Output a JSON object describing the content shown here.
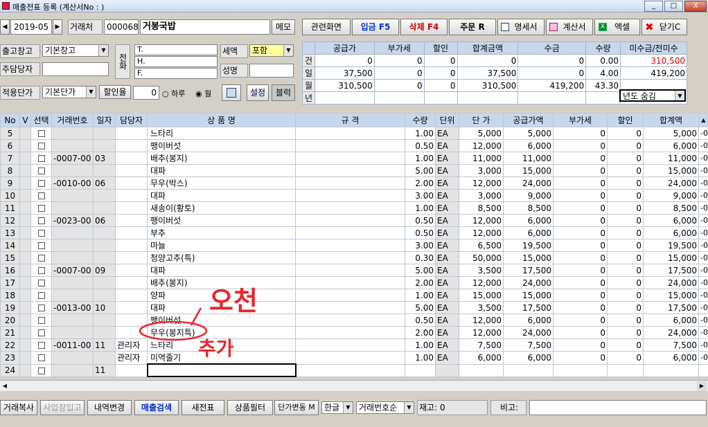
{
  "window": {
    "title": "매출전표 등록 (계산서No : )",
    "min": "_",
    "max": "□",
    "close": "X"
  },
  "header": {
    "date": "2019-05",
    "partner_label": "거래처",
    "partner_code": "000068",
    "partner_name": "거봉국밥",
    "memo_label": "메모"
  },
  "toolbar": {
    "related": "관련화면",
    "deposit": "입금 F5",
    "delete": "삭제 F4",
    "order": "주문 R",
    "statement": "명세서",
    "invoice": "계산서",
    "excel": "엑셀",
    "close": "닫기C"
  },
  "form": {
    "warehouse_label": "출고창고",
    "warehouse_value": "기본창고",
    "staff_label": "주담당자",
    "staff_value": "",
    "price_label": "적용단가",
    "price_value": "기본단가",
    "discount_label": "할인율",
    "discount_value": "0",
    "radio_day": "하루",
    "radio_month": "월",
    "setting_label": "설정",
    "block_label": "블럭",
    "phone_label": "전화",
    "phone_T": "T.",
    "phone_H": "H.",
    "phone_F": "F.",
    "tax_label": "세액",
    "tax_value": "포함",
    "name_label": "성명",
    "name_value": ""
  },
  "summary": {
    "headers": [
      "",
      "공급가",
      "부가세",
      "할인",
      "합계금액",
      "수금",
      "수량",
      "미수금/전미수"
    ],
    "rows": [
      [
        "건",
        "0",
        "0",
        "0",
        "0",
        "0",
        "0.00",
        "310,500"
      ],
      [
        "일",
        "37,500",
        "0",
        "0",
        "37,500",
        "0",
        "4.00",
        "419,200"
      ],
      [
        "월",
        "310,500",
        "0",
        "0",
        "310,500",
        "419,200",
        "43.30",
        ""
      ],
      [
        "년",
        "",
        "",
        "",
        "",
        "",
        "",
        ""
      ]
    ],
    "year_combo": "년도 숨김"
  },
  "grid": {
    "headers": [
      "No",
      "V",
      "선택",
      "거래번호",
      "일자",
      "담당자",
      "상 품 명",
      "규 격",
      "수량",
      "단위",
      "단 가",
      "공급가액",
      "부가세",
      "할인",
      "합계액"
    ],
    "rows": [
      {
        "no": "5",
        "tx": "",
        "date": "",
        "staff": "",
        "name": "느타리",
        "qty": "1.00",
        "unit": "EA",
        "price": "5,000",
        "supply": "5,000",
        "vat": "0",
        "disc": "0",
        "total": "5,000"
      },
      {
        "no": "6",
        "tx": "",
        "date": "",
        "staff": "",
        "name": "팽이버섯",
        "qty": "0.50",
        "unit": "EA",
        "price": "12,000",
        "supply": "6,000",
        "vat": "0",
        "disc": "0",
        "total": "6,000"
      },
      {
        "no": "7",
        "tx": "-0007-00",
        "date": "03",
        "staff": "",
        "name": "배추(봉지)",
        "qty": "1.00",
        "unit": "EA",
        "price": "11,000",
        "supply": "11,000",
        "vat": "0",
        "disc": "0",
        "total": "11,000"
      },
      {
        "no": "8",
        "tx": "",
        "date": "",
        "staff": "",
        "name": "대파",
        "qty": "5.00",
        "unit": "EA",
        "price": "3,000",
        "supply": "15,000",
        "vat": "0",
        "disc": "0",
        "total": "15,000"
      },
      {
        "no": "9",
        "tx": "-0010-00",
        "date": "06",
        "staff": "",
        "name": "무우(박스)",
        "qty": "2.00",
        "unit": "EA",
        "price": "12,000",
        "supply": "24,000",
        "vat": "0",
        "disc": "0",
        "total": "24,000"
      },
      {
        "no": "10",
        "tx": "",
        "date": "",
        "staff": "",
        "name": "대파",
        "qty": "3.00",
        "unit": "EA",
        "price": "3,000",
        "supply": "9,000",
        "vat": "0",
        "disc": "0",
        "total": "9,000"
      },
      {
        "no": "11",
        "tx": "",
        "date": "",
        "staff": "",
        "name": "새송이(황토)",
        "qty": "1.00",
        "unit": "EA",
        "price": "8,500",
        "supply": "8,500",
        "vat": "0",
        "disc": "0",
        "total": "8,500"
      },
      {
        "no": "12",
        "tx": "-0023-00",
        "date": "06",
        "staff": "",
        "name": "팽이버섯",
        "qty": "0.50",
        "unit": "EA",
        "price": "12,000",
        "supply": "6,000",
        "vat": "0",
        "disc": "0",
        "total": "6,000"
      },
      {
        "no": "13",
        "tx": "",
        "date": "",
        "staff": "",
        "name": "부추",
        "qty": "0.50",
        "unit": "EA",
        "price": "12,000",
        "supply": "6,000",
        "vat": "0",
        "disc": "0",
        "total": "6,000"
      },
      {
        "no": "14",
        "tx": "",
        "date": "",
        "staff": "",
        "name": "마늘",
        "qty": "3.00",
        "unit": "EA",
        "price": "6,500",
        "supply": "19,500",
        "vat": "0",
        "disc": "0",
        "total": "19,500"
      },
      {
        "no": "15",
        "tx": "",
        "date": "",
        "staff": "",
        "name": "청양고추(특)",
        "qty": "0.30",
        "unit": "EA",
        "price": "50,000",
        "supply": "15,000",
        "vat": "0",
        "disc": "0",
        "total": "15,000"
      },
      {
        "no": "16",
        "tx": "-0007-00",
        "date": "09",
        "staff": "",
        "name": "대파",
        "qty": "5.00",
        "unit": "EA",
        "price": "3,500",
        "supply": "17,500",
        "vat": "0",
        "disc": "0",
        "total": "17,500"
      },
      {
        "no": "17",
        "tx": "",
        "date": "",
        "staff": "",
        "name": "배추(봉지)",
        "qty": "2.00",
        "unit": "EA",
        "price": "12,000",
        "supply": "24,000",
        "vat": "0",
        "disc": "0",
        "total": "24,000"
      },
      {
        "no": "18",
        "tx": "",
        "date": "",
        "staff": "",
        "name": "양파",
        "qty": "1.00",
        "unit": "EA",
        "price": "15,000",
        "supply": "15,000",
        "vat": "0",
        "disc": "0",
        "total": "15,000"
      },
      {
        "no": "19",
        "tx": "-0013-00",
        "date": "10",
        "staff": "",
        "name": "대파",
        "qty": "5.00",
        "unit": "EA",
        "price": "3,500",
        "supply": "17,500",
        "vat": "0",
        "disc": "0",
        "total": "17,500"
      },
      {
        "no": "20",
        "tx": "",
        "date": "",
        "staff": "",
        "name": "팽이버섯",
        "qty": "0.50",
        "unit": "EA",
        "price": "12,000",
        "supply": "6,000",
        "vat": "0",
        "disc": "0",
        "total": "6,000"
      },
      {
        "no": "21",
        "tx": "",
        "date": "",
        "staff": "",
        "name": "무우(봉지특)",
        "qty": "2.00",
        "unit": "EA",
        "price": "12,000",
        "supply": "24,000",
        "vat": "0",
        "disc": "0",
        "total": "24,000"
      },
      {
        "no": "22",
        "tx": "-0011-00",
        "date": "11",
        "staff": "관리자",
        "name": "느타리",
        "qty": "1.00",
        "unit": "EA",
        "price": "7,500",
        "supply": "7,500",
        "vat": "0",
        "disc": "0",
        "total": "7,500"
      },
      {
        "no": "23",
        "tx": "",
        "date": "",
        "staff": "관리자",
        "name": "미역줄기",
        "qty": "1.00",
        "unit": "EA",
        "price": "6,000",
        "supply": "6,000",
        "vat": "0",
        "disc": "0",
        "total": "6,000"
      },
      {
        "no": "24",
        "tx": "",
        "date": "11",
        "staff": "",
        "name": "",
        "qty": "",
        "unit": "",
        "price": "",
        "supply": "",
        "vat": "",
        "disc": "",
        "total": ""
      }
    ]
  },
  "bottom": {
    "copy": "거래복사",
    "site_in": "사업장입고",
    "change": "내역변경",
    "search": "매출검색",
    "new": "새전표",
    "filter": "상품필터",
    "price_change": "단가변동 M",
    "lang": "한글",
    "sort": "거래번호순",
    "stock": "재고: 0",
    "remark_label": "비고:",
    "remark_value": ""
  },
  "annotations": {
    "a1": "오천",
    "a2": "추가"
  }
}
